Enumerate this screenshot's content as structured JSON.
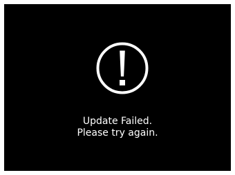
{
  "screen": {
    "background": "#000000",
    "icon": "exclamation-circle-icon",
    "icon_color": "#ffffff",
    "message": {
      "line1": "Update Failed.",
      "line2": "Please try again."
    },
    "text_color": "#ffffff"
  }
}
